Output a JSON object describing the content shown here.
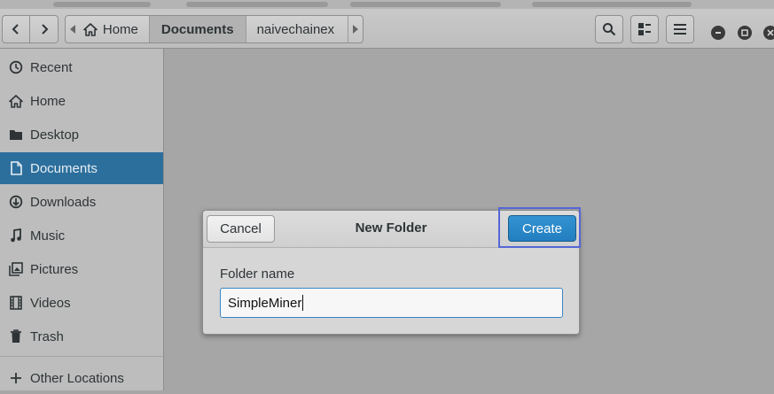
{
  "header": {
    "breadcrumbs": [
      "Home",
      "Documents",
      "naivechainex"
    ],
    "back_icon": "chevron-left-icon",
    "forward_icon": "chevron-right-icon",
    "search_icon": "search-icon",
    "view_icon": "grid-view-icon",
    "menu_icon": "hamburger-menu-icon"
  },
  "sidebar": {
    "items": [
      {
        "label": "Recent",
        "icon": "clock-icon"
      },
      {
        "label": "Home",
        "icon": "home-icon"
      },
      {
        "label": "Desktop",
        "icon": "folder-icon"
      },
      {
        "label": "Documents",
        "icon": "document-icon",
        "active": true
      },
      {
        "label": "Downloads",
        "icon": "download-icon"
      },
      {
        "label": "Music",
        "icon": "music-icon"
      },
      {
        "label": "Pictures",
        "icon": "picture-icon"
      },
      {
        "label": "Videos",
        "icon": "film-icon"
      },
      {
        "label": "Trash",
        "icon": "trash-icon"
      },
      {
        "label": "Other Locations",
        "icon": "plus-icon"
      }
    ]
  },
  "dialog": {
    "title": "New Folder",
    "cancel_label": "Cancel",
    "create_label": "Create",
    "field_label": "Folder name",
    "field_value": "SimpleMiner"
  },
  "colors": {
    "accent": "#2d6f9c",
    "create_button": "#2a86c8",
    "highlight": "#5566d6"
  }
}
